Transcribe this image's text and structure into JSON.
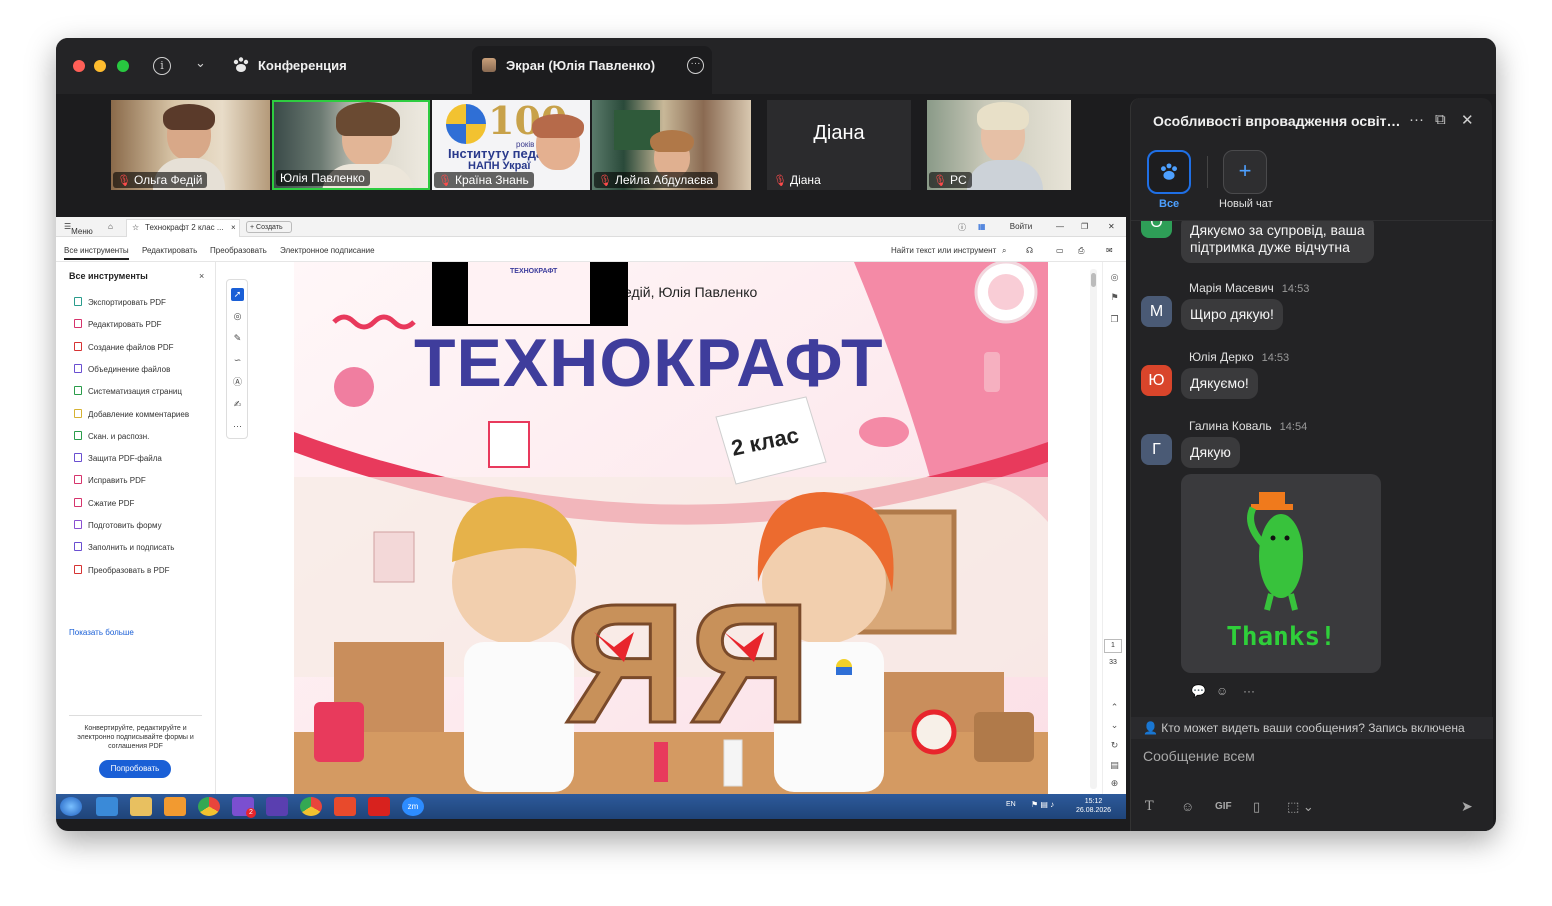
{
  "titlebar": {
    "conference_label": "Конференция",
    "screen_tab_label": "Экран (Юлія Павленко)"
  },
  "participants": [
    {
      "name": "Ольга Федій",
      "muted": true
    },
    {
      "name": "Юлія Павленко",
      "muted": false,
      "active_speaker": true
    },
    {
      "name": "Країна Знань",
      "muted": true
    },
    {
      "name": "Лейла Абдулаєва",
      "muted": true
    },
    {
      "name": "Діана",
      "muted": true,
      "big_label": "Діана"
    },
    {
      "name": "PC",
      "muted": true
    }
  ],
  "tile_overlay": {
    "line1": "рокiв",
    "line2": "Інституту педаг",
    "line3": "НАПН Украї",
    "number": "100"
  },
  "shared_screen": {
    "acrobat_top": {
      "menu": "Меню",
      "tab_title": "Технокрафт 2 клас ...",
      "tab_close": "×",
      "new_tab": "+ Создать",
      "login": "Войти"
    },
    "acrobat_menu": {
      "items": [
        "Все инструменты",
        "Редактировать",
        "Преобразовать",
        "Электронное подписание"
      ],
      "search": "Найти текст или инструмент"
    },
    "tools_panel": {
      "title": "Все инструменты",
      "close": "×",
      "tools": [
        {
          "label": "Экспортировать PDF",
          "color": "#2a9c8c"
        },
        {
          "label": "Редактировать PDF",
          "color": "#d6336c"
        },
        {
          "label": "Создание файлов PDF",
          "color": "#d63333"
        },
        {
          "label": "Объединение файлов",
          "color": "#6a4fd1"
        },
        {
          "label": "Систематизация страниц",
          "color": "#2a9c4a"
        },
        {
          "label": "Добавление комментариев",
          "color": "#d6b233"
        },
        {
          "label": "Скан. и распозн.",
          "color": "#2a9c4a"
        },
        {
          "label": "Защита PDF-файла",
          "color": "#6a4fd1"
        },
        {
          "label": "Исправить PDF",
          "color": "#d6336c"
        },
        {
          "label": "Сжатие PDF",
          "color": "#d6336c"
        },
        {
          "label": "Подготовить форму",
          "color": "#8a4fd1"
        },
        {
          "label": "Заполнить и подписать",
          "color": "#6a4fd1"
        },
        {
          "label": "Преобразовать в PDF",
          "color": "#d63333"
        }
      ],
      "show_more": "Показать больше",
      "promo_text": "Конвертируйте, редактируйте и электронно подписывайте формы и соглашения PDF",
      "promo_button": "Попробовать"
    },
    "page_counter": {
      "current": "1",
      "total": "33"
    },
    "cover": {
      "authors_partial": "едій, Юлія Павленко",
      "title": "ТЕХНОКРАФТ",
      "grade": "2 клас",
      "letter": "Я",
      "thumb_title": "ТЕХНОКРАФТ"
    },
    "taskbar": {
      "lang": "EN",
      "time": "15:12",
      "date": "26.08.2026",
      "badge": "2",
      "zoom_icon_label": "zm"
    }
  },
  "chat": {
    "title": "Особливості впровадження освітньої...",
    "channels": [
      {
        "label": "Все",
        "active": true
      },
      {
        "label": "Новый чат",
        "active": false
      }
    ],
    "messages": [
      {
        "initial": "О",
        "color": "#2e9e57",
        "sender": "",
        "time": "",
        "lines": [
          "Дякуємо за супровід, ваша",
          "підтримка дуже відчутна"
        ]
      },
      {
        "initial": "М",
        "color": "#4a5a75",
        "sender": "Марія Масевич",
        "time": "14:53",
        "lines": [
          "Щиро дякую!"
        ]
      },
      {
        "initial": "Ю",
        "color": "#d9452b",
        "sender": "Юлія Дерко",
        "time": "14:53",
        "lines": [
          "Дякуємо!"
        ]
      },
      {
        "initial": "Г",
        "color": "#4a5a75",
        "sender": "Галина Коваль",
        "time": "14:54",
        "lines": [
          "Дякую"
        ]
      }
    ],
    "sticker_text": "Thanks!",
    "visibility_text": "Кто может видеть ваши сообщения? Запись включена",
    "input_placeholder": "Сообщение всем",
    "format_gif": "GIF"
  }
}
